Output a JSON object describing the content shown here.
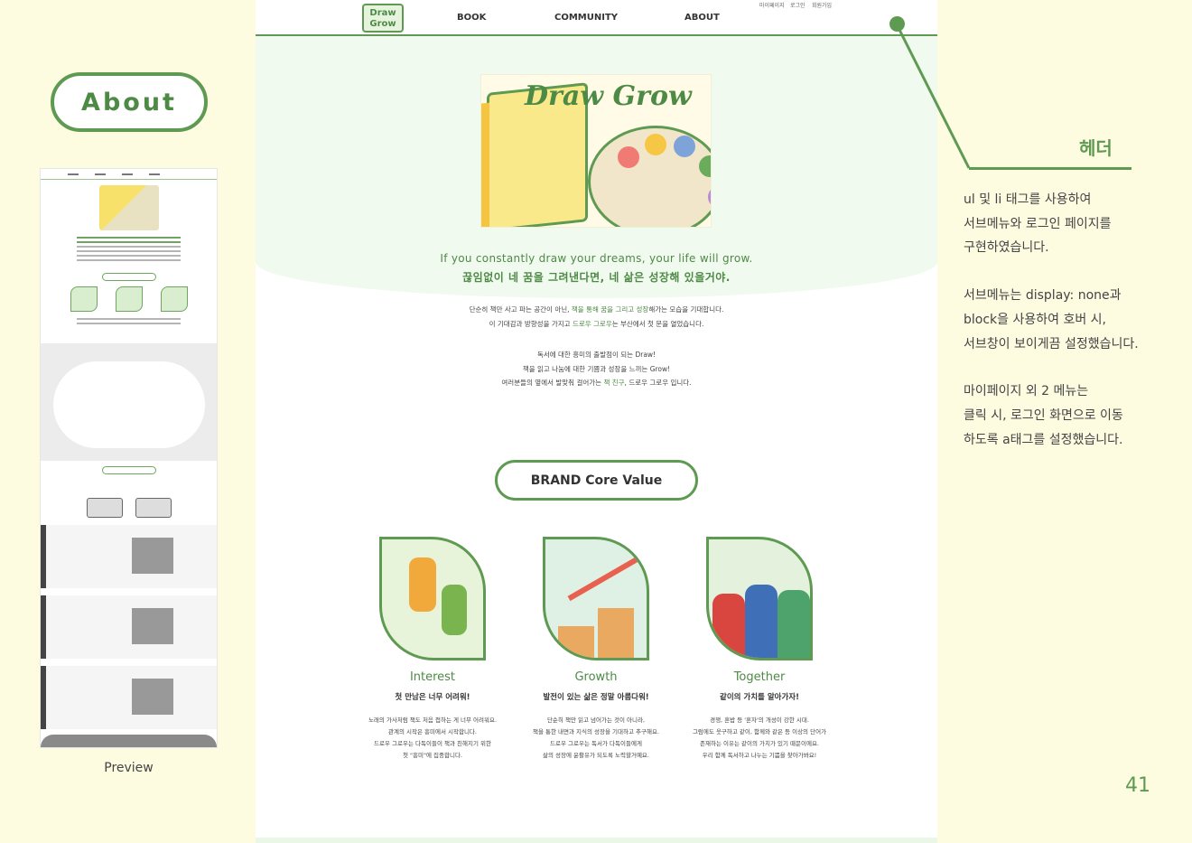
{
  "section_badge": "About",
  "preview_label": "Preview",
  "header": {
    "logo_text_1": "Draw",
    "logo_text_2": "Grow",
    "nav": [
      "BOOK",
      "COMMUNITY",
      "ABOUT"
    ],
    "util": [
      "마이페이지",
      "로그인",
      "회원가입"
    ]
  },
  "hero": {
    "title": "Draw Grow",
    "slogan_en": "If you constantly draw your dreams, your life will grow.",
    "slogan_ko": "끊임없이 네 꿈을 그려낸다면, 네 삶은 성장해 있을거야."
  },
  "intro": {
    "p1_l1_a": "단순히 책만 사고 파는 공간이 아닌, ",
    "p1_l1_g": "책을 통해 꿈을 그리고 성장",
    "p1_l1_b": "해가는 모습을 기대합니다.",
    "p1_l2_a": "이 기대감과 방향성을 가지고 ",
    "p1_l2_g": "드로우 그로우",
    "p1_l2_b": "는 부산에서 첫 문을 열었습니다.",
    "p2_l1": "독서에 대한 흥미의 출발점이 되는 Draw!",
    "p2_l2": "책을 읽고 나눔에 대한 기쁨과 성장을 느끼는 Grow!",
    "p2_l3_a": "여러분들의 옆에서 발맞춰 걸어가는 ",
    "p2_l3_g": "책 친구",
    "p2_l3_b": ", 드로우 그로우 입니다."
  },
  "core_value": {
    "title": "BRAND Core Value",
    "cards": [
      {
        "title": "Interest",
        "subtitle": "첫 만남은 너무 어려워!",
        "body": [
          "노래의 가사처럼 책도 처음 접하는 게 너무 어려워요.",
          "관계의 시작은 흥미에서 시작합니다.",
          "드로우 그로우는 다독이들이 책과 친해지기 위한",
          "첫 \"흥미\"에 집중합니다."
        ]
      },
      {
        "title": "Growth",
        "subtitle": "발전이 있는 삶은 정말 아름다워!",
        "body": [
          "단순히 책만 읽고 넘어가는 것이 아니라,",
          "책을 통한 내면과 지식의 성장을 기대하고 추구해요.",
          "드로우 그로우는 독서가 다독이들에게",
          "삶의 성장에 윤활유가 되도록 노력할거예요."
        ]
      },
      {
        "title": "Together",
        "subtitle": "같이의 가치를 알아가자!",
        "body": [
          "경쟁, 혼밥 등 '혼자'의 개성이 강한 시대.",
          "그럼에도 웃구하고 같이, 함께와 같은 등 이상의 단어가",
          "존재하는 이유는 같이의 가치가 있기 때문이에요.",
          "우리 함께 독서하고 나누는 기쁨을 찾아가봐요!"
        ]
      }
    ]
  },
  "callout": {
    "heading": "헤더",
    "paragraphs": [
      [
        "ul 및 li 태그를 사용하여",
        "서브메뉴와 로그인 페이지를",
        "구현하였습니다."
      ],
      [
        "서브메뉴는 display: none과",
        "block을 사용하여 호버 시,",
        "서브창이 보이게끔 설정했습니다."
      ],
      [
        "마이페이지 외 2  메뉴는",
        "클릭 시, 로그인 화면으로 이동",
        "하도록 a태그를 설정했습니다."
      ]
    ]
  },
  "page_number": "41",
  "colors": {
    "accent": "#5f9a52",
    "background": "#fdfbe0",
    "hero_bg": "#f1faef"
  }
}
